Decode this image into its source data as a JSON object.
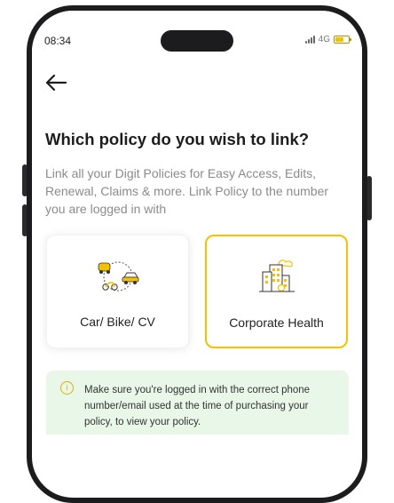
{
  "status_bar": {
    "time": "08:34",
    "network": "4G",
    "icons": [
      "signal-icon",
      "battery-icon"
    ]
  },
  "nav": {
    "back_icon": "arrow-left-icon"
  },
  "page": {
    "title": "Which policy do you wish to link?",
    "description": "Link all your Digit Policies for Easy Access, Edits, Renewal, Claims & more. Link Policy to the number you are logged in with"
  },
  "policy_options": [
    {
      "label": "Car/ Bike/ CV",
      "icon": "vehicles-icon",
      "selected": false
    },
    {
      "label": "Corporate Health",
      "icon": "corporate-building-icon",
      "selected": true
    }
  ],
  "info": {
    "icon": "info-icon",
    "text": "Make sure you're logged in with the correct phone number/email used at the time of purchasing your policy, to view your policy."
  },
  "colors": {
    "accent": "#f2c200",
    "info_background": "#e9f7e9",
    "title": "#1d1d1f",
    "muted_text": "#8b8b8b"
  }
}
